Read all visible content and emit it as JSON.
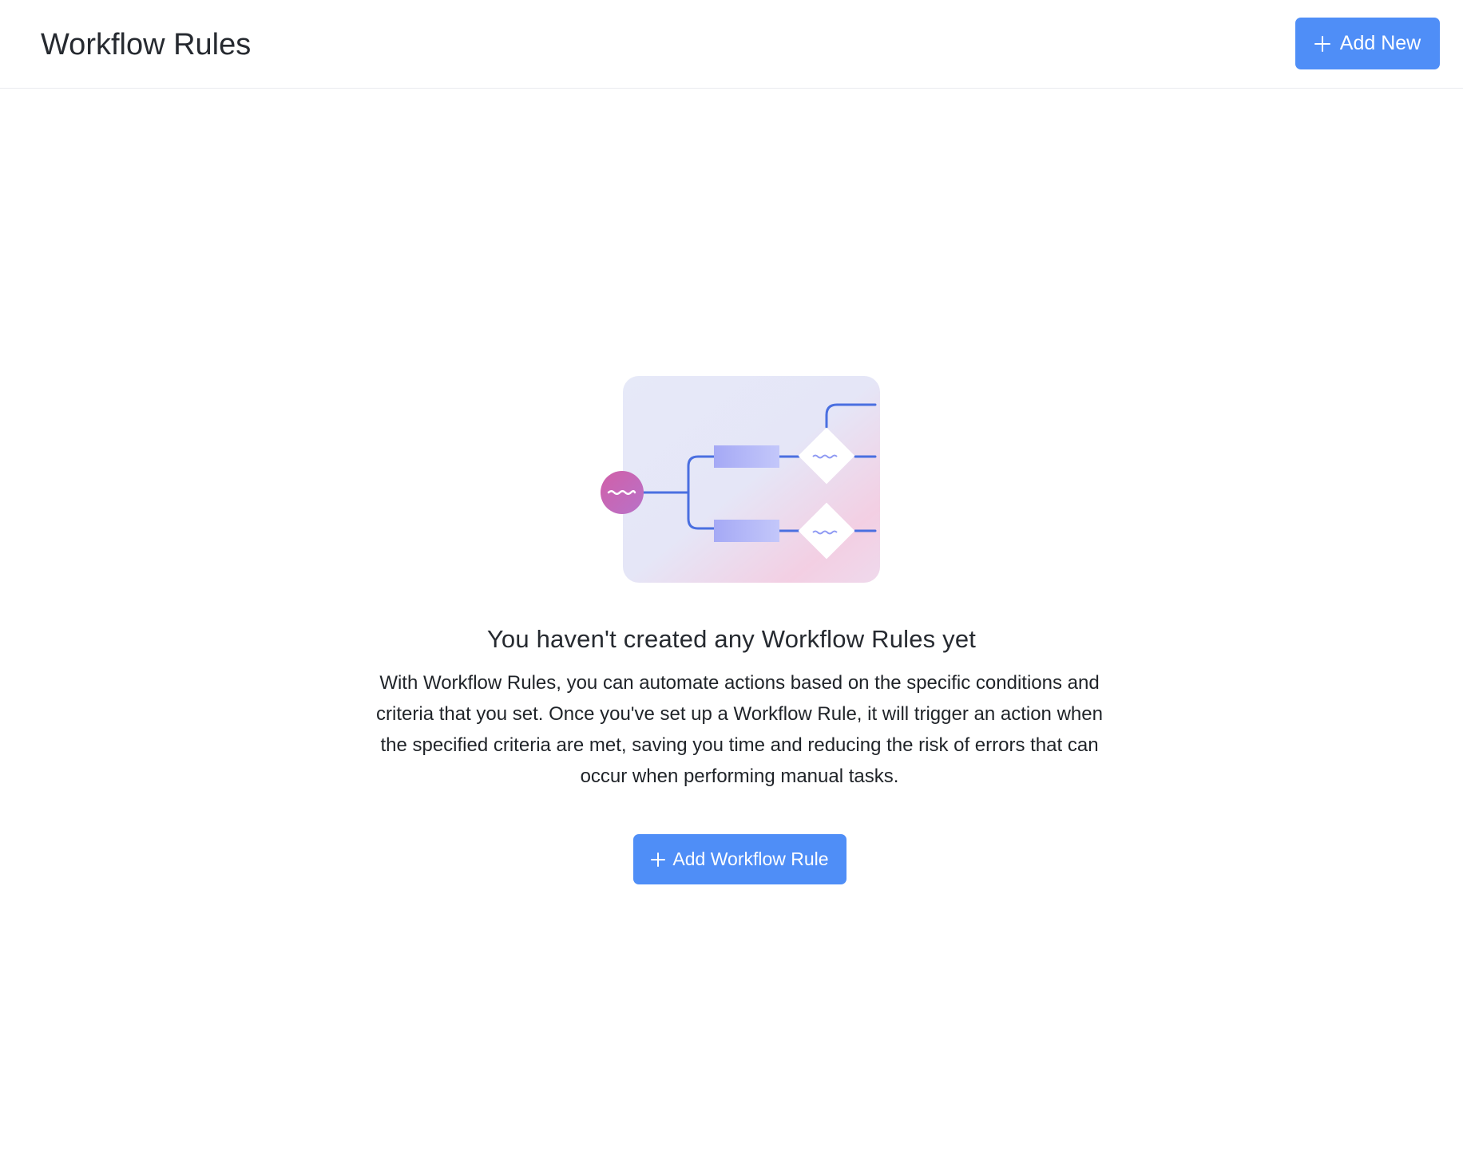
{
  "header": {
    "title": "Workflow Rules",
    "add_new_label": "Add New"
  },
  "empty_state": {
    "title": "You haven't created any Workflow Rules yet",
    "description": "With Workflow Rules, you can automate actions based on the specific conditions and criteria that you set. Once you've set up a Workflow Rule, it will trigger an action when the specified criteria are met, saving you time and reducing the risk of errors that can occur when performing manual tasks.",
    "cta_label": "Add Workflow Rule",
    "illustration": "workflow-diagram-illustration"
  },
  "colors": {
    "primary": "#4f8ef7",
    "text": "#1f2328",
    "divider": "#e9ebee"
  },
  "icons": {
    "plus": "plus-icon"
  }
}
